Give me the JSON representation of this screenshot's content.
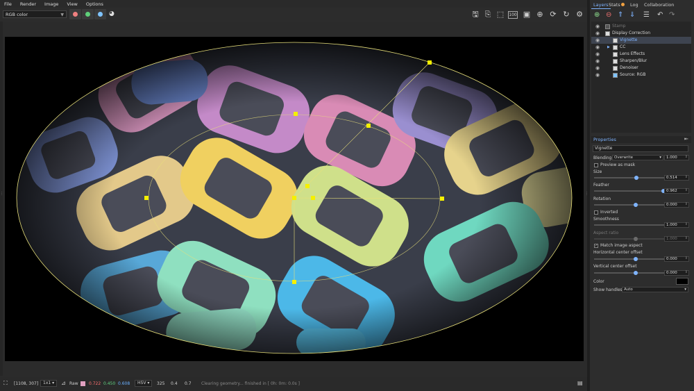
{
  "menu": [
    "File",
    "Render",
    "Image",
    "View",
    "Options"
  ],
  "toolbar": {
    "mode": "RGB color",
    "channel_colors": [
      "#f08080",
      "#5fd07a",
      "#7fc4ff"
    ],
    "icons": [
      "save-icon",
      "export-icon",
      "fit-view-icon",
      "zoom-100-icon",
      "zoom-to-fit-icon",
      "zoom-in-icon",
      "rotate-icon",
      "refresh-icon",
      "settings-icon",
      "camera-icon"
    ],
    "zoom_label": "100"
  },
  "status": {
    "coords": "[1108, 307]",
    "scale": "1x1",
    "raw_label": "Raw",
    "raw_swatch": "#e0a0c0",
    "r": "0.722",
    "g": "0.450",
    "b": "0.608",
    "color_model": "HSV",
    "h": "325",
    "s": "0.4",
    "v": "0.7",
    "message": "Clearing geometry... finished in [ 0h: 0m: 0.0s ]",
    "colors": {
      "r": "#ff7070",
      "g": "#60d080",
      "b": "#6ab0ff"
    }
  },
  "panel": {
    "tabs": [
      "Layers",
      "Stats",
      "Log",
      "Collaboration"
    ],
    "active_tab": "Layers",
    "layers": [
      {
        "label": "Stamp",
        "indent": 0,
        "dim": true
      },
      {
        "label": "Display Correction",
        "indent": 0
      },
      {
        "label": "Vignette",
        "indent": 1,
        "selected": true
      },
      {
        "label": "CC",
        "indent": 1
      },
      {
        "label": "Lens Effects",
        "indent": 1
      },
      {
        "label": "Sharpen/Blur",
        "indent": 1
      },
      {
        "label": "Denoiser",
        "indent": 1
      },
      {
        "label": "Source: RGB",
        "indent": 1
      }
    ],
    "properties_title": "Properties",
    "layer_name": "Vignette",
    "blending_label": "Blending",
    "blending_value": "Overwrite",
    "blending_amount": "1.000",
    "preview_mask": "Preview as mask",
    "size_label": "Size",
    "size_value": "0.514",
    "size_fraction": 0.51,
    "feather_label": "Feather",
    "feather_value": "0.962",
    "feather_fraction": 0.83,
    "rotation_label": "Rotation",
    "rotation_value": "0.000",
    "rotation_fraction": 0.5,
    "inverted_label": "Inverted",
    "smoothness_label": "Smoothness",
    "smoothness_value": "1.000",
    "smoothness_fraction": 1.0,
    "aspect_label": "Aspect ratio",
    "aspect_value": "1.000",
    "aspect_fraction": 0.5,
    "match_aspect": "Match image aspect",
    "hoffset_label": "Horizontal center offset",
    "hoffset_value": "0.000",
    "hoffset_fraction": 0.5,
    "voffset_label": "Vertical center offset",
    "voffset_value": "0.000",
    "voffset_fraction": 0.5,
    "color_label": "Color",
    "color_value": "#000000",
    "handles_label": "Show handles",
    "handles_value": "Auto"
  }
}
